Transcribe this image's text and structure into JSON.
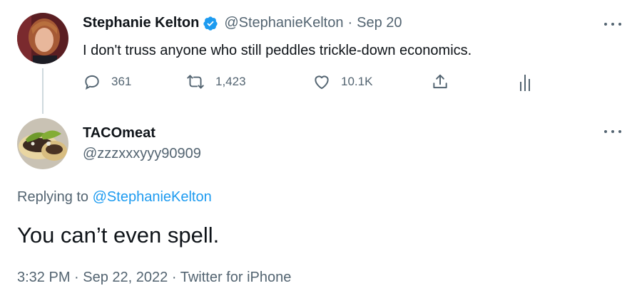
{
  "original_tweet": {
    "author_name": "Stephanie Kelton",
    "verified": true,
    "handle": "@StephanieKelton",
    "separator": "·",
    "date": "Sep 20",
    "text": "I don't truss anyone who still peddles trickle-down economics.",
    "actions": {
      "replies": "361",
      "retweets": "1,423",
      "likes": "10.1K"
    }
  },
  "reply_tweet": {
    "author_name": "TACOmeat",
    "handle": "@zzzxxxyyy90909",
    "replying_prefix": "Replying to",
    "replying_to": "@StephanieKelton",
    "text": "You can’t even spell.",
    "time": "3:32 PM",
    "date": "Sep 22, 2022",
    "separator": "·",
    "source": "Twitter for iPhone"
  },
  "colors": {
    "verified_badge": "#1d9bf0",
    "link": "#1d9bf0",
    "secondary_text": "#536471"
  }
}
